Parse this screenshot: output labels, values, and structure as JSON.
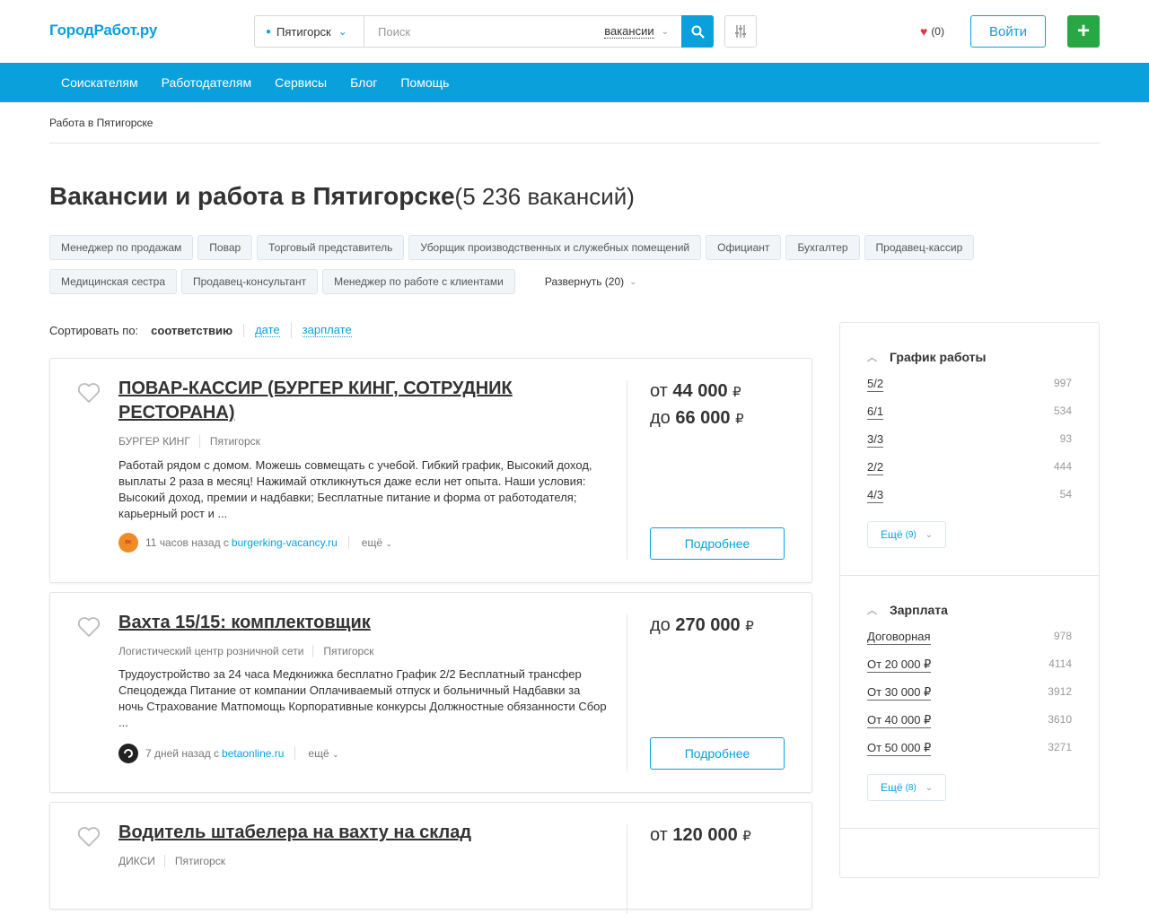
{
  "header": {
    "logo": "ГородРабот.ру",
    "city": "Пятигорск",
    "search_placeholder": "Поиск",
    "search_type": "вакансии",
    "favorites_count": "(0)",
    "login_label": "Войти",
    "add_label": "+"
  },
  "nav": [
    "Соискателям",
    "Работодателям",
    "Сервисы",
    "Блог",
    "Помощь"
  ],
  "breadcrumb": "Работа в Пятигорске",
  "page": {
    "title": "Вакансии и работа в Пятигорске",
    "count": "(5 236 вакансий)"
  },
  "tags_row1": [
    "Менеджер по продажам",
    "Повар",
    "Торговый представитель",
    "Уборщик производственных и служебных помещений",
    "Официант",
    "Бухгалтер",
    "Продавец-кассир"
  ],
  "tags_row2": [
    "Медицинская сестра",
    "Продавец-консультант",
    "Менеджер по работе с клиентами"
  ],
  "expand_label": "Развернуть (20)",
  "sort": {
    "label": "Сортировать по:",
    "active": "соответствию",
    "options": [
      "дате",
      "зарплате"
    ]
  },
  "jobs": [
    {
      "title": "ПОВАР-КАССИР (БУРГЕР КИНГ, СОТРУДНИК РЕСТОРАНА)",
      "company": "БУРГЕР КИНГ",
      "city": "Пятигорск",
      "description": "Работай рядом с домом. Можешь совмещать с учебой. Гибкий график, Высокий доход, выплаты 2 раза в месяц! Нажимай откликнуться даже если нет опыта. Наши условия: Высокий доход, премии и надбавки; Бесплатные питание и форма от работодателя; карьерный рост и ...",
      "time": "11 часов назад с",
      "source": "burgerking-vacancy.ru",
      "more": "ещё",
      "salary_from": "от",
      "salary_from_value": "44 000",
      "salary_to": "до",
      "salary_to_value": "66 000",
      "currency": "₽",
      "button": "Подробнее"
    },
    {
      "title": "Вахта 15/15: комплектовщик",
      "company": "Логистический центр розничной сети",
      "city": "Пятигорск",
      "description": "Трудоустройство за 24 часа Медкнижка бесплатно График 2/2 Бесплатный трансфер Спецодежда Питание от компании Оплачиваемый отпуск и больничный Надбавки за ночь Страхование Матпомощь Корпоративные конкурсы Должностные обязанности Сбор ...",
      "time": "7 дней назад с",
      "source": "betaonline.ru",
      "more": "ещё",
      "salary_to": "до",
      "salary_to_value": "270 000",
      "currency": "₽",
      "button": "Подробнее"
    },
    {
      "title": "Водитель штабелера на вахту на склад",
      "company": "ДИКСИ",
      "city": "Пятигорск",
      "salary_from": "от",
      "salary_from_value": "120 000",
      "currency": "₽"
    }
  ],
  "sidebar": {
    "schedule": {
      "title": "График работы",
      "items": [
        {
          "name": "5/2",
          "count": "997"
        },
        {
          "name": "6/1",
          "count": "534"
        },
        {
          "name": "3/3",
          "count": "93"
        },
        {
          "name": "2/2",
          "count": "444"
        },
        {
          "name": "4/3",
          "count": "54"
        }
      ],
      "more": "Ещё",
      "more_count": "(9)"
    },
    "salary": {
      "title": "Зарплата",
      "items": [
        {
          "name": "Договорная",
          "count": "978"
        },
        {
          "name": "От 20 000 ₽",
          "count": "4114"
        },
        {
          "name": "От 30 000 ₽",
          "count": "3912"
        },
        {
          "name": "От 40 000 ₽",
          "count": "3610"
        },
        {
          "name": "От 50 000 ₽",
          "count": "3271"
        }
      ],
      "more": "Ещё",
      "more_count": "(8)"
    }
  },
  "colors": {
    "accent": "#0aa0dc",
    "add_button": "#28a745",
    "heart": "#d83a3a"
  }
}
